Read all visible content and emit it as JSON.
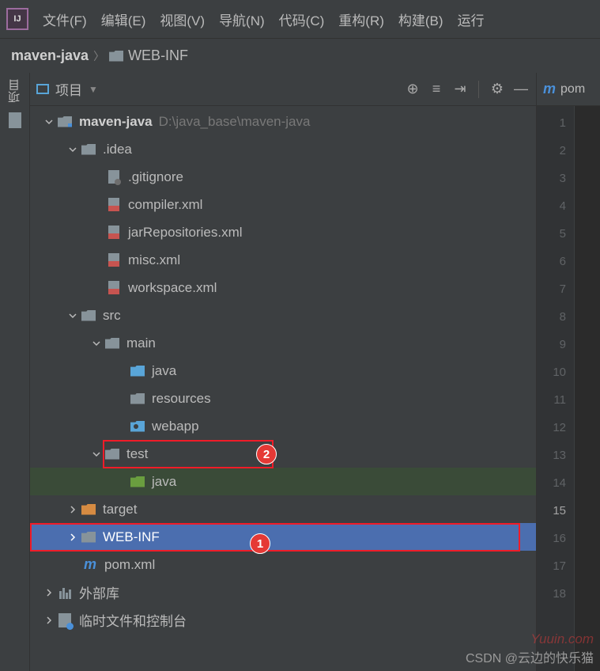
{
  "menu": {
    "items": [
      "文件(F)",
      "编辑(E)",
      "视图(V)",
      "导航(N)",
      "代码(C)",
      "重构(R)",
      "构建(B)",
      "运行"
    ]
  },
  "breadcrumb": {
    "root": "maven-java",
    "child": "WEB-INF"
  },
  "panel": {
    "title": "项目"
  },
  "tree": {
    "root": {
      "name": "maven-java",
      "path": "D:\\java_base\\maven-java"
    },
    "idea": ".idea",
    "files_idea": [
      ".gitignore",
      "compiler.xml",
      "jarRepositories.xml",
      "misc.xml",
      "workspace.xml"
    ],
    "src": "src",
    "main": "main",
    "java": "java",
    "resources": "resources",
    "webapp": "webapp",
    "test": "test",
    "testjava": "java",
    "target": "target",
    "webinf": "WEB-INF",
    "pom": "pom.xml",
    "extlib": "外部库",
    "scratch": "临时文件和控制台"
  },
  "editor": {
    "tab": "pom",
    "lines": [
      "1",
      "2",
      "3",
      "4",
      "5",
      "6",
      "7",
      "8",
      "9",
      "10",
      "11",
      "12",
      "13",
      "14",
      "15",
      "16",
      "17",
      "18"
    ]
  },
  "annot": {
    "b1": "1",
    "b2": "2"
  },
  "watermark": "Yuuin.com",
  "csdn": "CSDN @云边的快乐猫"
}
